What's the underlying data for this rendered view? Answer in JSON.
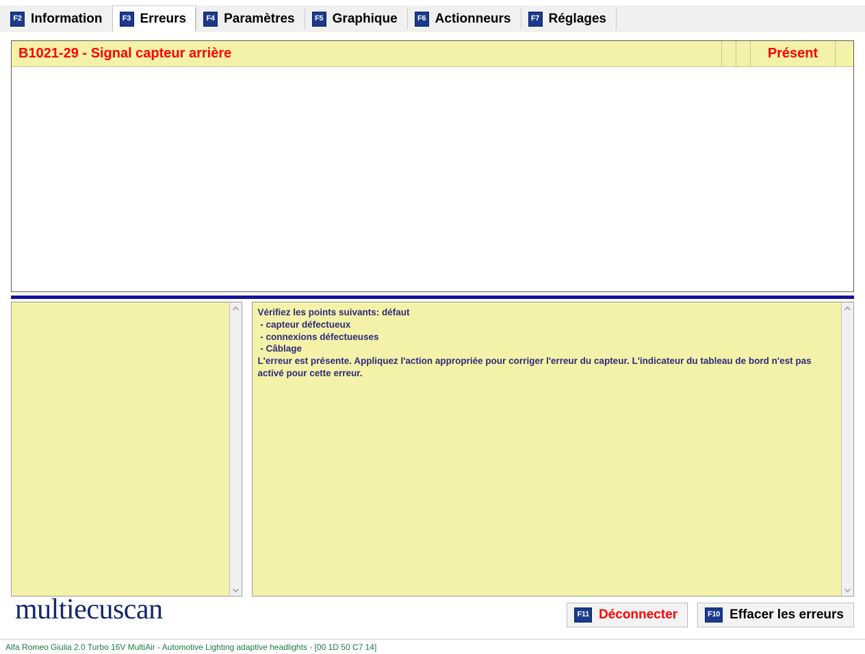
{
  "tabs": [
    {
      "key": "F2",
      "label": "Information",
      "active": false,
      "name": "tab-information"
    },
    {
      "key": "F3",
      "label": "Erreurs",
      "active": true,
      "name": "tab-erreurs"
    },
    {
      "key": "F4",
      "label": "Paramètres",
      "active": false,
      "name": "tab-parametres"
    },
    {
      "key": "F5",
      "label": "Graphique",
      "active": false,
      "name": "tab-graphique"
    },
    {
      "key": "F6",
      "label": "Actionneurs",
      "active": false,
      "name": "tab-actionneurs"
    },
    {
      "key": "F7",
      "label": "Réglages",
      "active": false,
      "name": "tab-reglages"
    }
  ],
  "error_list": {
    "rows": [
      {
        "code": "B1021-29 - Signal capteur arrière",
        "col2": "",
        "col3": "",
        "status": "Présent",
        "col5": ""
      }
    ]
  },
  "left_panel": {
    "text": ""
  },
  "description_panel": {
    "text": "Vérifiez les points suivants: défaut\n - capteur défectueux\n - connexions défectueuses\n - Câblage\nL'erreur est présente. Appliquez l'action appropriée pour corriger l'erreur du capteur. L'indicateur du tableau de bord n'est pas activé pour cette erreur."
  },
  "scrollbars": {
    "up_icon": "chevron-up-icon",
    "down_icon": "chevron-down-icon"
  },
  "footer": {
    "logo": "multiecuscan",
    "buttons": [
      {
        "key": "F11",
        "label": "Déconnecter",
        "color": "red",
        "name": "disconnect-button"
      },
      {
        "key": "F10",
        "label": "Effacer les erreurs",
        "color": "black",
        "name": "clear-errors-button"
      }
    ]
  },
  "statusbar": {
    "text": "Alfa Romeo Giulia 2.0 Turbo 16V MultiAir - Automotive Lighting adaptive headlights - [00 1D 50 C7 14]"
  },
  "colors": {
    "accent_blue": "#1b3a8c",
    "splitter_blue": "#13129c",
    "row_yellow": "#f4f2a8",
    "error_red": "#ff0000",
    "desc_text": "#2c2a7a",
    "status_green": "#1a7a3c",
    "logo_navy": "#16276b"
  }
}
